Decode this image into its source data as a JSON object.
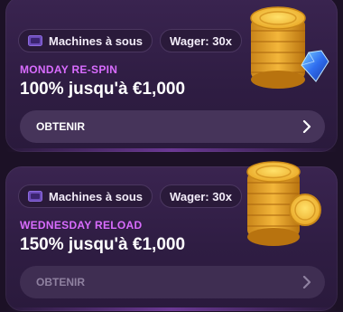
{
  "promos": [
    {
      "category_label": "Machines à sous",
      "wager_label": "Wager: 30x",
      "promo_name": "MONDAY RE-SPIN",
      "promo_title": "100% jusqu'à €1,000",
      "claim_label": "OBTENIR",
      "art_icon": "coins-gem-icon"
    },
    {
      "category_label": "Machines à sous",
      "wager_label": "Wager: 30x",
      "promo_name": "WEDNESDAY RELOAD",
      "promo_title": "150% jusqu'à €1,000",
      "claim_label": "OBTENIR",
      "art_icon": "coins-icon"
    }
  ],
  "colors": {
    "accent": "#d96cff",
    "card_bg": "#3a2450",
    "button_bg": "#46345a"
  }
}
